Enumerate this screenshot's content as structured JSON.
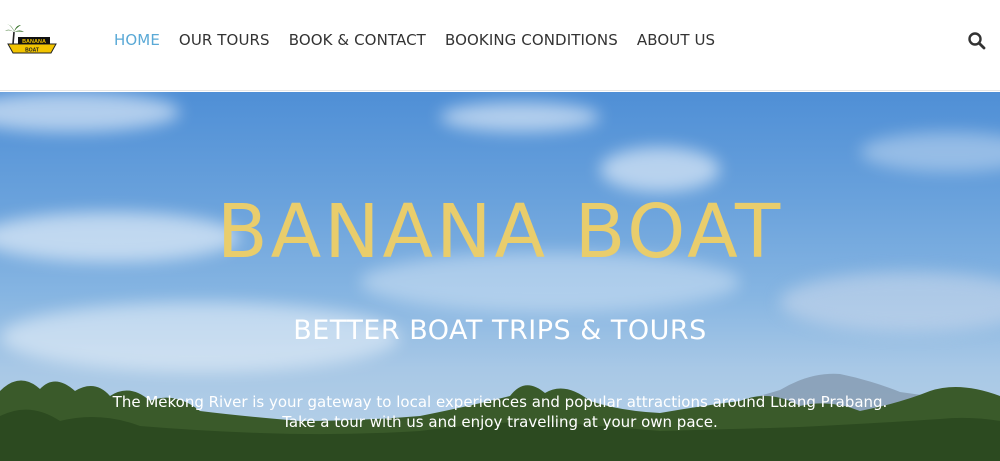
{
  "header": {
    "logo_text": "BANANA BOAT",
    "nav": [
      {
        "label": "HOME",
        "active": true
      },
      {
        "label": "OUR TOURS",
        "active": false
      },
      {
        "label": "BOOK & CONTACT",
        "active": false
      },
      {
        "label": "BOOKING CONDITIONS",
        "active": false
      },
      {
        "label": "ABOUT US",
        "active": false
      }
    ],
    "search_icon": "search-icon",
    "active_color": "#5aa9d6"
  },
  "hero": {
    "title": "BANANA BOAT",
    "subtitle": "BETTER BOAT TRIPS & TOURS",
    "description_line1": "The Mekong River is your gateway to local experiences and popular attractions around Luang Prabang.",
    "description_line2": "Take a tour with us and enjoy travelling at your own pace.",
    "title_color": "#e9cd6c"
  }
}
